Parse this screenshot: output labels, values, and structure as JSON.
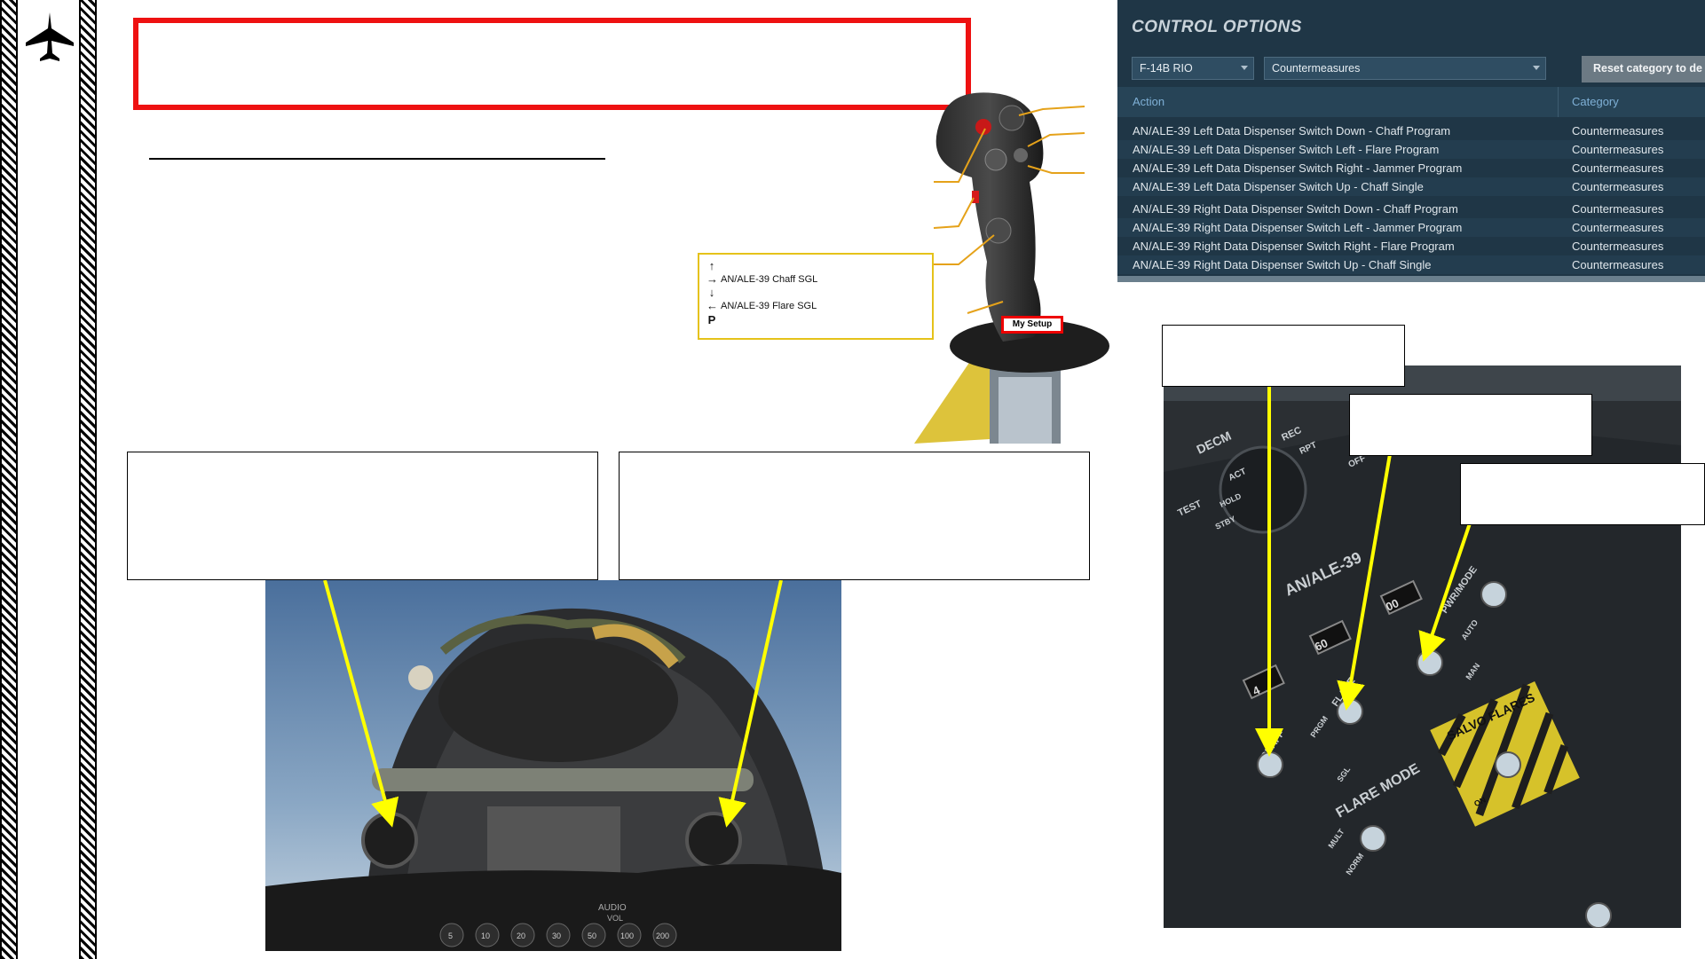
{
  "title": "",
  "subtitle": "",
  "legend": {
    "rows": [
      {
        "arrow": "↑",
        "label": ""
      },
      {
        "arrow": "→",
        "label": "AN/ALE-39 Chaff SGL"
      },
      {
        "arrow": "↓",
        "label": ""
      },
      {
        "arrow": "←",
        "label": "AN/ALE-39 Flare SGL"
      },
      {
        "arrow": "P",
        "label": ""
      }
    ]
  },
  "my_setup": "My Setup",
  "control_options": {
    "title": "CONTROL OPTIONS",
    "aircraft": "F-14B RIO",
    "category": "Countermeasures",
    "reset_label": "Reset category to de",
    "col_action": "Action",
    "col_category": "Category",
    "rows": [
      {
        "action": "AN/ALE-39 Left Data Dispenser Switch Down - Chaff Program",
        "category": "Countermeasures"
      },
      {
        "action": "AN/ALE-39 Left Data Dispenser Switch Left - Flare Program",
        "category": "Countermeasures"
      },
      {
        "action": "AN/ALE-39 Left Data Dispenser Switch Right - Jammer Program",
        "category": "Countermeasures"
      },
      {
        "action": "AN/ALE-39 Left Data Dispenser Switch Up - Chaff Single",
        "category": "Countermeasures"
      },
      {
        "action": "AN/ALE-39 Right Data Dispenser Switch Down - Chaff Program",
        "category": "Countermeasures"
      },
      {
        "action": "AN/ALE-39 Right Data Dispenser Switch Left - Jammer Program",
        "category": "Countermeasures"
      },
      {
        "action": "AN/ALE-39 Right Data Dispenser Switch Right - Flare Program",
        "category": "Countermeasures"
      },
      {
        "action": "AN/ALE-39 Right Data Dispenser Switch Up - Chaff Single",
        "category": "Countermeasures"
      }
    ]
  },
  "panel_labels": {
    "decm": "DECM",
    "rec": "REC",
    "rpt": "RPT",
    "off": "OFF",
    "act": "ACT",
    "test": "TEST",
    "hold": "HOLD",
    "stby": "STBY",
    "ale39": "AN/ALE-39",
    "chaff": "CHAFF",
    "flare": "FLARE",
    "pwr_mode": "PWR/MODE",
    "flare_mode": "FLARE MODE",
    "salvo_flares": "SALVO FLARES",
    "prgm": "PRGM",
    "sgl": "SGL",
    "auto": "AUTO",
    "man": "MAN",
    "mult": "MULT",
    "norm": "NORM",
    "on": "ON",
    "counter_a": "4",
    "counter_b": "60",
    "counter_c": "00"
  },
  "cockpit_gauge_labels": [
    "5",
    "10",
    "20",
    "30",
    "50",
    "100",
    "200"
  ],
  "cockpit_audio": "AUDIO",
  "cockpit_vol": "VOL",
  "colors": {
    "title_border": "#ee1111",
    "arrow": "#ffff00",
    "legend_border": "#e5c21a",
    "panel_bg": "#1f3646"
  }
}
